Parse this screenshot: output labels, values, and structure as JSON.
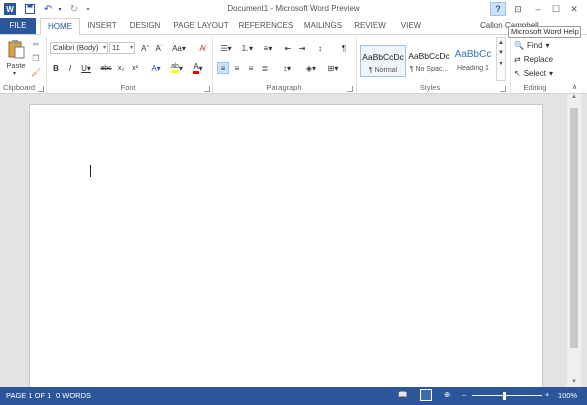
{
  "title": "Document1 - Microsoft Word Preview",
  "user": "Callon Campbell",
  "tooltip": "Microsoft Word Help",
  "tabs": [
    "FILE",
    "HOME",
    "INSERT",
    "DESIGN",
    "PAGE LAYOUT",
    "REFERENCES",
    "MAILINGS",
    "REVIEW",
    "VIEW"
  ],
  "groups": {
    "clipboard": "Clipboard",
    "font": "Font",
    "paragraph": "Paragraph",
    "styles": "Styles",
    "editing": "Editing"
  },
  "clipboard": {
    "paste": "Paste"
  },
  "font": {
    "family": "Calibri (Body)",
    "size": "11"
  },
  "styles": [
    {
      "sample": "AaBbCcDc",
      "name": "¶ Normal"
    },
    {
      "sample": "AaBbCcDc",
      "name": "¶ No Spac..."
    },
    {
      "sample": "AaBbCc",
      "name": "Heading 1"
    }
  ],
  "editing": {
    "find": "Find",
    "replace": "Replace",
    "select": "Select"
  },
  "status": {
    "page": "PAGE 1 OF 1",
    "words": "0 WORDS",
    "zoom": "100%"
  },
  "zoom_level": 0.5,
  "colors": {
    "brand": "#2b579a",
    "highlight": "#ffff00",
    "font_color": "#ff0000"
  }
}
